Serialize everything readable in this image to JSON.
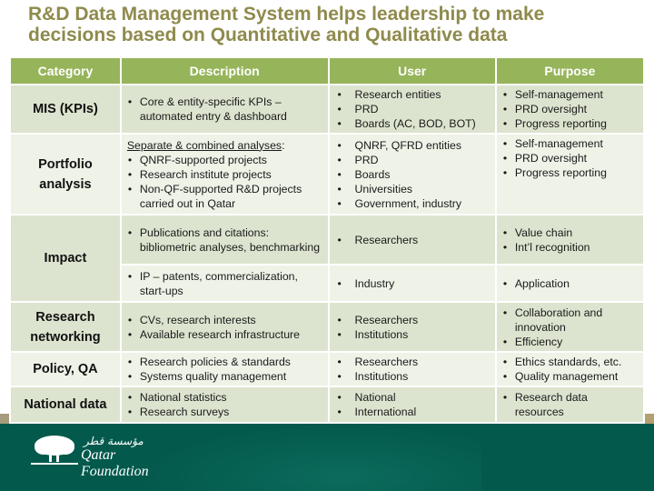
{
  "title": {
    "line1": "R&D Data Management System helps leadership to make",
    "line2": "decisions based on Quantitative and Qualitative data"
  },
  "colors": {
    "title": "#8f8a4c",
    "header_bg": "#96b45a",
    "row_dark": "#dce4cf",
    "row_light": "#eef2e7",
    "footer_bg": "#03594c"
  },
  "table": {
    "headers": [
      "Category",
      "Description",
      "User",
      "Purpose"
    ],
    "rows": [
      {
        "category": "MIS (KPIs)",
        "description": {
          "items": [
            "Core & entity-specific KPIs – automated entry & dashboard"
          ]
        },
        "user": [
          "Research entities",
          "PRD",
          "Boards (AC, BOD, BOT)"
        ],
        "purpose": [
          "Self-management",
          "PRD oversight",
          "Progress reporting"
        ]
      },
      {
        "category": "Portfolio analysis",
        "description": {
          "intro": "Separate & combined analyses",
          "intro_suffix": ":",
          "items": [
            "QNRF-supported projects",
            "Research institute projects",
            "Non-QF-supported R&D projects carried out in Qatar"
          ]
        },
        "user": [
          "QNRF, QFRD entities",
          "PRD",
          "Boards",
          "Universities",
          "Government, industry"
        ],
        "purpose": [
          "Self-management",
          "PRD oversight",
          "Progress reporting"
        ]
      },
      {
        "category": "Impact",
        "description": {
          "items": [
            "Publications and citations: bibliometric analyses, benchmarking"
          ]
        },
        "user": [
          "Researchers"
        ],
        "purpose": [
          "Value chain",
          "Int’l recognition"
        ]
      },
      {
        "category": "",
        "description": {
          "items": [
            "IP – patents, commercialization, start-ups"
          ]
        },
        "user": [
          "Industry"
        ],
        "purpose": [
          "Application"
        ]
      },
      {
        "category": "Research networking",
        "description": {
          "items": [
            "CVs, research interests",
            "Available research infrastructure"
          ]
        },
        "user": [
          "Researchers",
          "Institutions"
        ],
        "purpose": [
          "Collaboration and innovation",
          "Efficiency"
        ]
      },
      {
        "category": "Policy, QA",
        "description": {
          "items": [
            "Research policies & standards",
            "Systems quality management"
          ]
        },
        "user": [
          "Researchers",
          "Institutions"
        ],
        "purpose": [
          "Ethics standards, etc.",
          "Quality management"
        ]
      },
      {
        "category": "National data",
        "description": {
          "items": [
            "National statistics",
            "Research surveys"
          ]
        },
        "user": [
          "National",
          "International"
        ],
        "purpose": [
          "Research data resources"
        ]
      }
    ]
  },
  "footer": {
    "logo_arabic": "مؤسسة قطر",
    "logo_name": "Qatar Foundation",
    "logo_icon": "tree-icon"
  }
}
